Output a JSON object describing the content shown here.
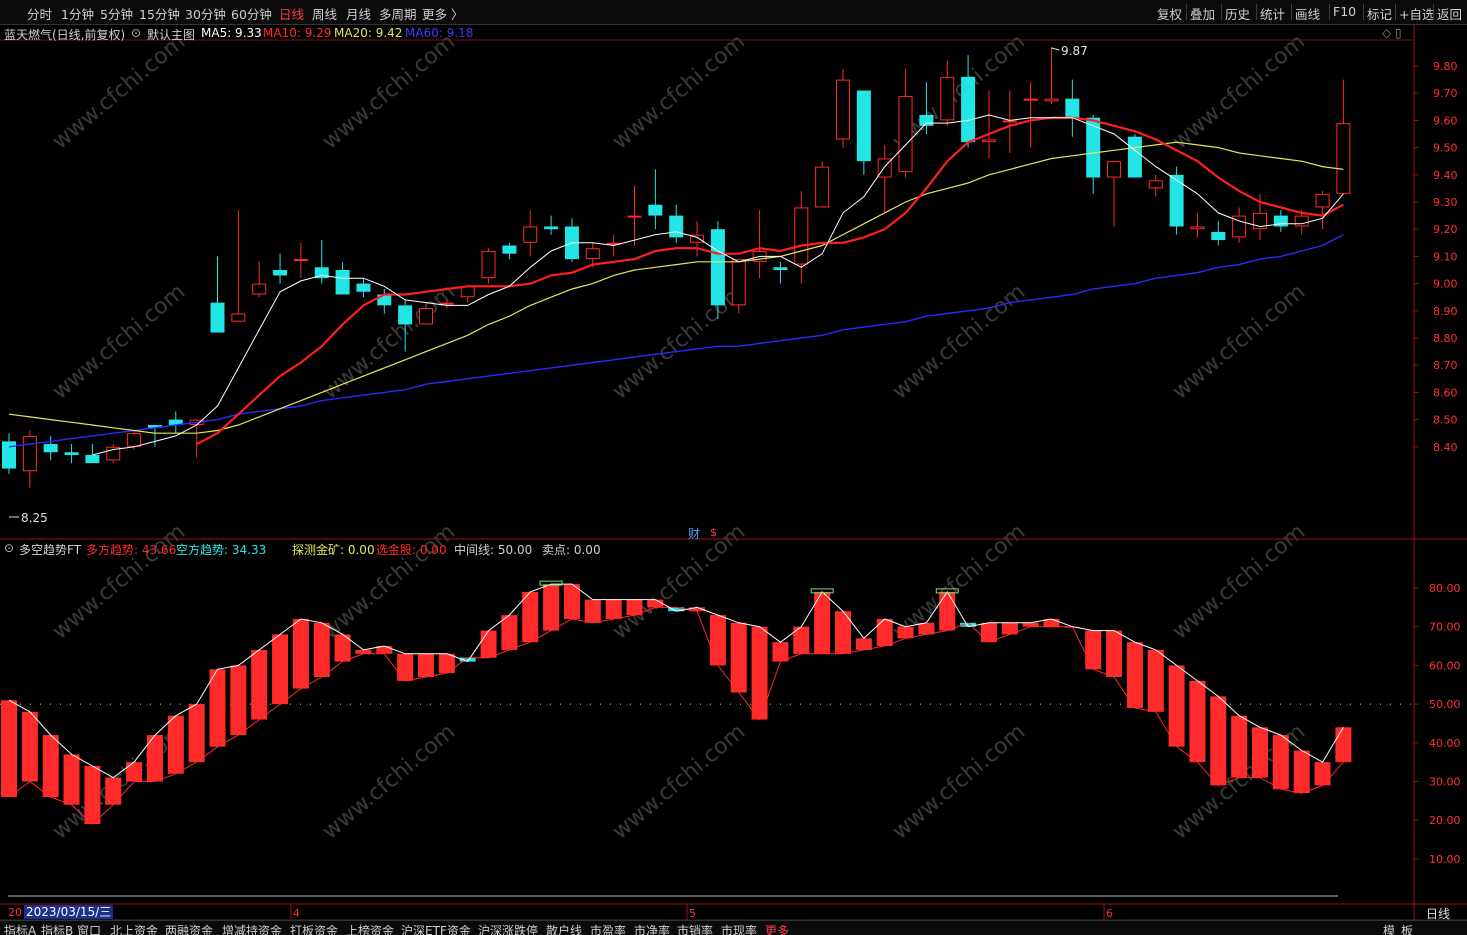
{
  "toolbar": {
    "periods": [
      "分时",
      "1分钟",
      "5分钟",
      "15分钟",
      "30分钟",
      "60分钟",
      "日线",
      "周线",
      "月线",
      "多周期",
      "更多 〉"
    ],
    "active_period": "日线",
    "right": [
      "复权",
      "叠加",
      "历史",
      "统计",
      "画线",
      "F10",
      "标记",
      "+自选",
      "返回"
    ]
  },
  "main_panel": {
    "stock_title": "蓝天燃气(日线,前复权)",
    "template": "默认主图",
    "ma5": "MA5: 9.33",
    "ma10": "MA10: 9.29",
    "ma20": "MA20: 9.42",
    "ma60": "MA60: 9.18",
    "high_label": "9.87",
    "low_label": "8.25",
    "y_ticks": [
      "9.80",
      "9.70",
      "9.60",
      "9.50",
      "9.40",
      "9.30",
      "9.20",
      "9.10",
      "9.00",
      "8.90",
      "8.80",
      "8.70",
      "8.60",
      "8.50",
      "8.40"
    ],
    "finance_badge": "财"
  },
  "indicator_panel": {
    "name": "多空趋势FT",
    "long_trend": "多方趋势: 43.66",
    "short_trend": "空方趋势: 34.33",
    "probe": "探测金矿: 0.00",
    "pick": "选金股: 0.00",
    "mid": "中间线: 50.00",
    "sell": "卖点: 0.00",
    "y_ticks": [
      "80.00",
      "70.00",
      "60.00",
      "50.00",
      "40.00",
      "30.00",
      "20.00",
      "10.00"
    ]
  },
  "x_axis": {
    "date_cursor": "2023/03/15/三",
    "months": [
      "4",
      "5",
      "6"
    ],
    "period_label": "日线"
  },
  "bottom_tabs": [
    "指标A",
    "指标B",
    "窗口",
    "北上资金",
    "两融资金",
    "增减持资金",
    "打板资金",
    "上榜资金",
    "沪深ETF资金",
    "沪深涨跌停",
    "散户线",
    "市盈率",
    "市净率",
    "市销率",
    "市现率",
    "更多"
  ],
  "bottom_right": [
    "模",
    "板"
  ],
  "watermark": "www.cfchi.com",
  "colors": {
    "up": "#ff2a2a",
    "down": "#22e6e6",
    "ma5": "#ffffff",
    "ma10": "#ff1f1f",
    "ma20": "#e6e65a",
    "ma60": "#2a2aff"
  },
  "chart_data": {
    "type": "candlestick",
    "candles": [
      {
        "o": 8.42,
        "h": 8.45,
        "l": 8.3,
        "c": 8.32
      },
      {
        "o": 8.31,
        "h": 8.46,
        "l": 8.25,
        "c": 8.44
      },
      {
        "o": 8.41,
        "h": 8.44,
        "l": 8.35,
        "c": 8.38
      },
      {
        "o": 8.38,
        "h": 8.41,
        "l": 8.34,
        "c": 8.37
      },
      {
        "o": 8.37,
        "h": 8.41,
        "l": 8.34,
        "c": 8.34
      },
      {
        "o": 8.35,
        "h": 8.41,
        "l": 8.34,
        "c": 8.4
      },
      {
        "o": 8.4,
        "h": 8.46,
        "l": 8.39,
        "c": 8.45
      },
      {
        "o": 8.48,
        "h": 8.48,
        "l": 8.4,
        "c": 8.47
      },
      {
        "o": 8.5,
        "h": 8.53,
        "l": 8.45,
        "c": 8.48
      },
      {
        "o": 8.48,
        "h": 8.5,
        "l": 8.36,
        "c": 8.5
      },
      {
        "o": 8.93,
        "h": 9.1,
        "l": 8.82,
        "c": 8.82
      },
      {
        "o": 8.86,
        "h": 9.27,
        "l": 8.86,
        "c": 8.89
      },
      {
        "o": 8.96,
        "h": 9.08,
        "l": 8.95,
        "c": 9.0
      },
      {
        "o": 9.05,
        "h": 9.11,
        "l": 9.0,
        "c": 9.03
      },
      {
        "o": 9.09,
        "h": 9.15,
        "l": 9.02,
        "c": 9.09
      },
      {
        "o": 9.06,
        "h": 9.16,
        "l": 9.0,
        "c": 9.02
      },
      {
        "o": 9.05,
        "h": 9.08,
        "l": 8.96,
        "c": 8.96
      },
      {
        "o": 9.0,
        "h": 9.02,
        "l": 8.95,
        "c": 8.97
      },
      {
        "o": 8.96,
        "h": 8.98,
        "l": 8.89,
        "c": 8.92
      },
      {
        "o": 8.92,
        "h": 8.94,
        "l": 8.75,
        "c": 8.85
      },
      {
        "o": 8.85,
        "h": 8.91,
        "l": 8.85,
        "c": 8.91
      },
      {
        "o": 8.93,
        "h": 8.94,
        "l": 8.91,
        "c": 8.93
      },
      {
        "o": 8.95,
        "h": 8.99,
        "l": 8.93,
        "c": 8.99
      },
      {
        "o": 9.02,
        "h": 9.13,
        "l": 9.0,
        "c": 9.12
      },
      {
        "o": 9.14,
        "h": 9.15,
        "l": 9.09,
        "c": 9.11
      },
      {
        "o": 9.15,
        "h": 9.27,
        "l": 9.1,
        "c": 9.21
      },
      {
        "o": 9.21,
        "h": 9.25,
        "l": 9.18,
        "c": 9.2
      },
      {
        "o": 9.21,
        "h": 9.24,
        "l": 9.08,
        "c": 9.09
      },
      {
        "o": 9.09,
        "h": 9.15,
        "l": 9.06,
        "c": 9.13
      },
      {
        "o": 9.15,
        "h": 9.18,
        "l": 9.1,
        "c": 9.15
      },
      {
        "o": 9.25,
        "h": 9.36,
        "l": 9.14,
        "c": 9.25
      },
      {
        "o": 9.29,
        "h": 9.42,
        "l": 9.2,
        "c": 9.25
      },
      {
        "o": 9.25,
        "h": 9.29,
        "l": 9.15,
        "c": 9.17
      },
      {
        "o": 9.15,
        "h": 9.23,
        "l": 9.1,
        "c": 9.18
      },
      {
        "o": 9.2,
        "h": 9.23,
        "l": 8.87,
        "c": 8.92
      },
      {
        "o": 8.92,
        "h": 9.09,
        "l": 8.89,
        "c": 9.09
      },
      {
        "o": 9.08,
        "h": 9.27,
        "l": 9.02,
        "c": 9.12
      },
      {
        "o": 9.06,
        "h": 9.08,
        "l": 9.0,
        "c": 9.05
      },
      {
        "o": 9.07,
        "h": 9.34,
        "l": 9.0,
        "c": 9.28
      },
      {
        "o": 9.28,
        "h": 9.45,
        "l": 9.28,
        "c": 9.43
      },
      {
        "o": 9.53,
        "h": 9.79,
        "l": 9.5,
        "c": 9.75
      },
      {
        "o": 9.71,
        "h": 9.71,
        "l": 9.4,
        "c": 9.45
      },
      {
        "o": 9.39,
        "h": 9.51,
        "l": 9.26,
        "c": 9.46
      },
      {
        "o": 9.41,
        "h": 9.79,
        "l": 9.39,
        "c": 9.69
      },
      {
        "o": 9.62,
        "h": 9.74,
        "l": 9.55,
        "c": 9.58
      },
      {
        "o": 9.6,
        "h": 9.82,
        "l": 9.58,
        "c": 9.76
      },
      {
        "o": 9.76,
        "h": 9.84,
        "l": 9.5,
        "c": 9.52
      },
      {
        "o": 9.52,
        "h": 9.71,
        "l": 9.46,
        "c": 9.53
      },
      {
        "o": 9.6,
        "h": 9.71,
        "l": 9.48,
        "c": 9.6
      },
      {
        "o": 9.68,
        "h": 9.74,
        "l": 9.5,
        "c": 9.68
      },
      {
        "o": 9.67,
        "h": 9.87,
        "l": 9.66,
        "c": 9.68
      },
      {
        "o": 9.68,
        "h": 9.75,
        "l": 9.54,
        "c": 9.61
      },
      {
        "o": 9.61,
        "h": 9.62,
        "l": 9.33,
        "c": 9.39
      },
      {
        "o": 9.39,
        "h": 9.45,
        "l": 9.21,
        "c": 9.45
      },
      {
        "o": 9.54,
        "h": 9.55,
        "l": 9.39,
        "c": 9.39
      },
      {
        "o": 9.35,
        "h": 9.4,
        "l": 9.32,
        "c": 9.38
      },
      {
        "o": 9.4,
        "h": 9.43,
        "l": 9.18,
        "c": 9.21
      },
      {
        "o": 9.2,
        "h": 9.26,
        "l": 9.17,
        "c": 9.21
      },
      {
        "o": 9.19,
        "h": 9.23,
        "l": 9.14,
        "c": 9.16
      },
      {
        "o": 9.17,
        "h": 9.28,
        "l": 9.15,
        "c": 9.25
      },
      {
        "o": 9.2,
        "h": 9.33,
        "l": 9.16,
        "c": 9.26
      },
      {
        "o": 9.25,
        "h": 9.27,
        "l": 9.19,
        "c": 9.21
      },
      {
        "o": 9.21,
        "h": 9.27,
        "l": 9.18,
        "c": 9.25
      },
      {
        "o": 9.28,
        "h": 9.34,
        "l": 9.2,
        "c": 9.33
      },
      {
        "o": 9.33,
        "h": 9.75,
        "l": 9.33,
        "c": 9.59
      }
    ],
    "ma5": [
      null,
      null,
      null,
      null,
      8.37,
      8.39,
      8.4,
      8.42,
      8.44,
      8.48,
      8.55,
      8.69,
      8.83,
      8.97,
      9.01,
      9.03,
      9.02,
      9.02,
      8.99,
      8.94,
      8.93,
      8.92,
      8.92,
      8.96,
      8.99,
      9.06,
      9.12,
      9.15,
      9.15,
      9.14,
      9.16,
      9.18,
      9.19,
      9.17,
      9.12,
      9.08,
      9.1,
      9.1,
      9.06,
      9.11,
      9.26,
      9.32,
      9.43,
      9.51,
      9.59,
      9.59,
      9.6,
      9.62,
      9.6,
      9.61,
      9.61,
      9.61,
      9.58,
      9.55,
      9.49,
      9.43,
      9.38,
      9.33,
      9.26,
      9.23,
      9.21,
      9.22,
      9.22,
      9.24,
      9.33
    ],
    "ma10": [
      null,
      null,
      null,
      null,
      null,
      null,
      null,
      null,
      null,
      8.41,
      8.45,
      8.52,
      8.59,
      8.66,
      8.71,
      8.77,
      8.85,
      8.92,
      8.96,
      8.96,
      8.97,
      8.98,
      8.99,
      8.99,
      8.99,
      9.0,
      9.03,
      9.04,
      9.07,
      9.08,
      9.09,
      9.12,
      9.13,
      9.13,
      9.11,
      9.11,
      9.13,
      9.12,
      9.14,
      9.15,
      9.15,
      9.17,
      9.2,
      9.26,
      9.35,
      9.45,
      9.52,
      9.55,
      9.58,
      9.6,
      9.61,
      9.61,
      9.6,
      9.58,
      9.56,
      9.53,
      9.49,
      9.45,
      9.39,
      9.34,
      9.3,
      9.28,
      9.26,
      9.25,
      9.29
    ],
    "ma20": [
      8.52,
      8.51,
      8.5,
      8.49,
      8.48,
      8.47,
      8.46,
      8.45,
      8.45,
      8.45,
      8.46,
      8.48,
      8.51,
      8.54,
      8.57,
      8.6,
      8.63,
      8.66,
      8.69,
      8.72,
      8.75,
      8.78,
      8.81,
      8.85,
      8.88,
      8.92,
      8.95,
      8.98,
      9.0,
      9.03,
      9.05,
      9.06,
      9.07,
      9.08,
      9.08,
      9.08,
      9.09,
      9.1,
      9.12,
      9.14,
      9.18,
      9.22,
      9.26,
      9.3,
      9.33,
      9.35,
      9.37,
      9.4,
      9.42,
      9.44,
      9.46,
      9.47,
      9.48,
      9.49,
      9.5,
      9.51,
      9.52,
      9.51,
      9.5,
      9.48,
      9.47,
      9.46,
      9.45,
      9.43,
      9.42
    ],
    "ma60": [
      8.4,
      8.41,
      8.42,
      8.43,
      8.44,
      8.45,
      8.46,
      8.47,
      8.48,
      8.49,
      8.5,
      8.52,
      8.53,
      8.54,
      8.55,
      8.57,
      8.58,
      8.59,
      8.6,
      8.61,
      8.63,
      8.64,
      8.65,
      8.66,
      8.67,
      8.68,
      8.69,
      8.7,
      8.71,
      8.72,
      8.73,
      8.74,
      8.75,
      8.76,
      8.77,
      8.77,
      8.78,
      8.79,
      8.8,
      8.81,
      8.83,
      8.84,
      8.85,
      8.86,
      8.88,
      8.89,
      8.9,
      8.91,
      8.93,
      8.94,
      8.95,
      8.96,
      8.98,
      8.99,
      9.0,
      9.02,
      9.03,
      9.04,
      9.06,
      9.07,
      9.09,
      9.1,
      9.12,
      9.14,
      9.18
    ],
    "trend": [
      {
        "o": 26,
        "c": 51
      },
      {
        "o": 30,
        "c": 48
      },
      {
        "o": 26,
        "c": 42
      },
      {
        "o": 24,
        "c": 37
      },
      {
        "o": 19,
        "c": 34
      },
      {
        "o": 24,
        "c": 31
      },
      {
        "o": 30,
        "c": 35
      },
      {
        "o": 30,
        "c": 42
      },
      {
        "o": 32,
        "c": 47
      },
      {
        "o": 35,
        "c": 50
      },
      {
        "o": 39,
        "c": 59
      },
      {
        "o": 42,
        "c": 60
      },
      {
        "o": 46,
        "c": 64
      },
      {
        "o": 50,
        "c": 68
      },
      {
        "o": 54,
        "c": 72
      },
      {
        "o": 57,
        "c": 71
      },
      {
        "o": 61,
        "c": 68
      },
      {
        "o": 63,
        "c": 64
      },
      {
        "o": 63,
        "c": 65
      },
      {
        "o": 56,
        "c": 63
      },
      {
        "o": 57,
        "c": 63
      },
      {
        "o": 58,
        "c": 63
      },
      {
        "o": 62,
        "c": 61
      },
      {
        "o": 62,
        "c": 69
      },
      {
        "o": 64,
        "c": 73
      },
      {
        "o": 66,
        "c": 79
      },
      {
        "o": 69,
        "c": 81
      },
      {
        "o": 72,
        "c": 81
      },
      {
        "o": 71,
        "c": 77
      },
      {
        "o": 72,
        "c": 77
      },
      {
        "o": 73,
        "c": 77
      },
      {
        "o": 75,
        "c": 77
      },
      {
        "o": 75,
        "c": 74
      },
      {
        "o": 74,
        "c": 75
      },
      {
        "o": 60,
        "c": 73
      },
      {
        "o": 53,
        "c": 71
      },
      {
        "o": 46,
        "c": 70
      },
      {
        "o": 61,
        "c": 66
      },
      {
        "o": 63,
        "c": 70
      },
      {
        "o": 63,
        "c": 79
      },
      {
        "o": 63,
        "c": 74
      },
      {
        "o": 64,
        "c": 67
      },
      {
        "o": 65,
        "c": 72
      },
      {
        "o": 67,
        "c": 70
      },
      {
        "o": 68,
        "c": 71
      },
      {
        "o": 69,
        "c": 79
      },
      {
        "o": 71,
        "c": 70
      },
      {
        "o": 66,
        "c": 71
      },
      {
        "o": 68,
        "c": 71
      },
      {
        "o": 70,
        "c": 71
      },
      {
        "o": 70,
        "c": 72
      },
      {
        "o": 70,
        "c": 70
      },
      {
        "o": 59,
        "c": 69
      },
      {
        "o": 57,
        "c": 69
      },
      {
        "o": 49,
        "c": 66
      },
      {
        "o": 48,
        "c": 64
      },
      {
        "o": 39,
        "c": 60
      },
      {
        "o": 35,
        "c": 56
      },
      {
        "o": 29,
        "c": 52
      },
      {
        "o": 31,
        "c": 47
      },
      {
        "o": 31,
        "c": 44
      },
      {
        "o": 28,
        "c": 42
      },
      {
        "o": 27,
        "c": 38
      },
      {
        "o": 29,
        "c": 35
      },
      {
        "o": 35,
        "c": 44
      }
    ]
  }
}
